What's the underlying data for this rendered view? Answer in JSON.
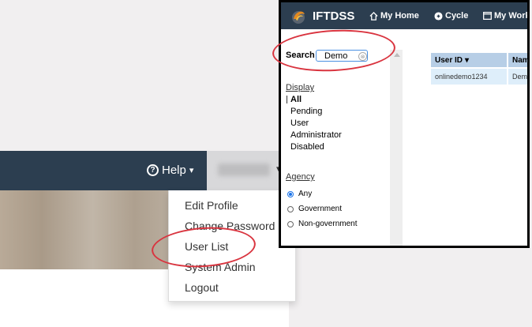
{
  "navbar": {
    "help_label": "Help",
    "help_caret": "▾",
    "user_caret": "▾"
  },
  "dropdown": {
    "items": [
      "Edit Profile",
      "Change Password",
      "User List",
      "System Admin",
      "Logout"
    ]
  },
  "inset": {
    "brand": "IFTDSS",
    "nav": {
      "home": "My Home",
      "cycle": "Cycle",
      "works": "My Works"
    },
    "search": {
      "label": "Search",
      "value": "Demo",
      "clear": "⊗"
    },
    "display": {
      "heading": "Display",
      "options": [
        "All",
        "Pending",
        "User",
        "Administrator",
        "Disabled"
      ],
      "selected": "All"
    },
    "agency": {
      "heading": "Agency",
      "options": [
        "Any",
        "Government",
        "Non-government"
      ],
      "selected": "Any"
    },
    "table": {
      "columns": [
        "User ID",
        "Name"
      ],
      "sort_indicator": "▾",
      "rows": [
        [
          "onlinedemo1234",
          "Demo"
        ]
      ]
    }
  },
  "colors": {
    "navbar": "#2c3e50",
    "highlight_circle": "#d9343f",
    "table_header": "#b7cee6",
    "table_row": "#deeefa"
  }
}
